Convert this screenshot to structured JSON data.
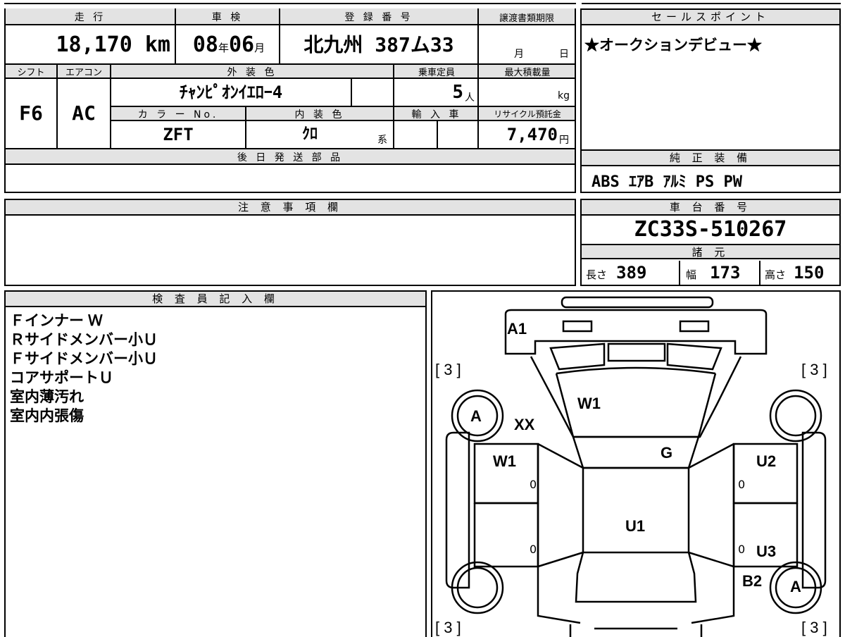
{
  "spec": {
    "mileage_label": "走 行",
    "mileage_value": "18,170",
    "mileage_unit": "km",
    "inspection_label": "車 検",
    "inspection_year": "08",
    "inspection_year_unit": "年",
    "inspection_month": "06",
    "inspection_month_unit": "月",
    "registration_label": "登 録 番 号",
    "registration_value": "北九州 387ム33",
    "transfer_label": "譲渡書類期限",
    "transfer_month_unit": "月",
    "transfer_day_unit": "日",
    "shift_label": "シフト",
    "shift_value": "F6",
    "aircon_label": "エアコン",
    "aircon_value": "AC",
    "exterior_label": "外 装 色",
    "exterior_value": "ﾁｬﾝﾋﾟｵﾝｲｴﾛｰ4",
    "capacity_label": "乗車定員",
    "capacity_value": "5",
    "capacity_unit": "人",
    "maxload_label": "最大積載量",
    "maxload_unit": "kg",
    "colorno_label": "カ ラ ー No.",
    "colorno_value": "ZFT",
    "interior_label": "内 装 色",
    "interior_value": "ｸﾛ",
    "interior_unit": "系",
    "import_label": "輸 入 車",
    "recycle_label": "リサイクル預託金",
    "recycle_value": "7,470",
    "recycle_unit": "円",
    "later_parts_label": "後 日 発 送 部 品"
  },
  "sales": {
    "label": "セールスポイント",
    "text": "★オークションデビュー★"
  },
  "equipment": {
    "label": "純 正 装 備",
    "text": "ABS ｴｱB ｱﾙﾐ PS PW"
  },
  "notes": {
    "label": "注 意 事 項 欄"
  },
  "chassis": {
    "label": "車 台 番 号",
    "value": "ZC33S-510267",
    "dims_label": "諸 元",
    "length_label": "長さ",
    "length_value": "389",
    "width_label": "幅",
    "width_value": "173",
    "height_label": "高さ",
    "height_value": "150"
  },
  "inspector": {
    "label": "検 査 員 記 入 欄",
    "lines": [
      "Ｆインナー Ｗ",
      "Ｒサイドメンバー小Ｕ",
      "Ｆサイドメンバー小Ｕ",
      "コアサポートＵ",
      "室内薄汚れ",
      "室内内張傷"
    ]
  },
  "diagram": {
    "marks": [
      "A1",
      "W1",
      "XX",
      "W1",
      "G",
      "U2",
      "U1",
      "U3",
      "B2",
      "A",
      "A"
    ],
    "tire_marks": [
      "[ 3 ]",
      "[ 3 ]",
      "[ 3 ]",
      "[ 3 ]"
    ],
    "zero": "0"
  }
}
